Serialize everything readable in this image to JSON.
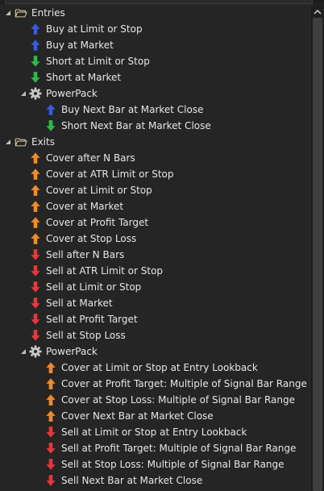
{
  "colors": {
    "background": "#252526",
    "text": "#e6e6e6",
    "buy": "#3a5bd9",
    "short": "#2fb84a",
    "cover": "#f08a2a",
    "sell": "#e03a3a"
  },
  "tree": [
    {
      "label": "Entries",
      "icon": "folder-open-icon",
      "level": 0,
      "expander": "expanded-icon"
    },
    {
      "label": "Buy at Limit or Stop",
      "icon": "buy-arrow-icon",
      "level": 1
    },
    {
      "label": "Buy at Market",
      "icon": "buy-arrow-icon",
      "level": 1
    },
    {
      "label": "Short at Limit or Stop",
      "icon": "short-arrow-icon",
      "level": 1
    },
    {
      "label": "Short at Market",
      "icon": "short-arrow-icon",
      "level": 1
    },
    {
      "label": "PowerPack",
      "icon": "gear-icon",
      "level": 1,
      "expander": "expanded-icon"
    },
    {
      "label": "Buy Next Bar at Market Close",
      "icon": "buy-arrow-icon",
      "level": 2
    },
    {
      "label": "Short Next Bar at Market Close",
      "icon": "short-arrow-icon",
      "level": 2
    },
    {
      "label": "Exits",
      "icon": "folder-open-icon",
      "level": 0,
      "expander": "expanded-icon"
    },
    {
      "label": "Cover after N Bars",
      "icon": "cover-arrow-icon",
      "level": 1
    },
    {
      "label": "Cover at ATR Limit or Stop",
      "icon": "cover-arrow-icon",
      "level": 1
    },
    {
      "label": "Cover at Limit or Stop",
      "icon": "cover-arrow-icon",
      "level": 1
    },
    {
      "label": "Cover at Market",
      "icon": "cover-arrow-icon",
      "level": 1
    },
    {
      "label": "Cover at Profit Target",
      "icon": "cover-arrow-icon",
      "level": 1
    },
    {
      "label": "Cover at Stop Loss",
      "icon": "cover-arrow-icon",
      "level": 1
    },
    {
      "label": "Sell after N Bars",
      "icon": "sell-arrow-icon",
      "level": 1
    },
    {
      "label": "Sell at ATR Limit or Stop",
      "icon": "sell-arrow-icon",
      "level": 1
    },
    {
      "label": "Sell at Limit or Stop",
      "icon": "sell-arrow-icon",
      "level": 1
    },
    {
      "label": "Sell at Market",
      "icon": "sell-arrow-icon",
      "level": 1
    },
    {
      "label": "Sell at Profit Target",
      "icon": "sell-arrow-icon",
      "level": 1
    },
    {
      "label": "Sell at Stop Loss",
      "icon": "sell-arrow-icon",
      "level": 1
    },
    {
      "label": "PowerPack",
      "icon": "gear-icon",
      "level": 1,
      "expander": "expanded-icon"
    },
    {
      "label": "Cover at Limit or Stop at Entry Lookback",
      "icon": "cover-arrow-icon",
      "level": 2
    },
    {
      "label": "Cover at Profit Target: Multiple of Signal Bar Range",
      "icon": "cover-arrow-icon",
      "level": 2
    },
    {
      "label": "Cover at Stop Loss: Multiple of Signal Bar Range",
      "icon": "cover-arrow-icon",
      "level": 2
    },
    {
      "label": "Cover Next Bar at Market Close",
      "icon": "cover-arrow-icon",
      "level": 2
    },
    {
      "label": "Sell at Limit or Stop at Entry Lookback",
      "icon": "sell-arrow-icon",
      "level": 2
    },
    {
      "label": "Sell at Profit Target: Multiple of Signal Bar Range",
      "icon": "sell-arrow-icon",
      "level": 2
    },
    {
      "label": "Sell at Stop Loss: Multiple of Signal Bar Range",
      "icon": "sell-arrow-icon",
      "level": 2
    },
    {
      "label": "Sell Next Bar at Market Close",
      "icon": "sell-arrow-icon",
      "level": 2
    }
  ],
  "scrollbar": {
    "up_icon": "chevron-up-icon"
  }
}
